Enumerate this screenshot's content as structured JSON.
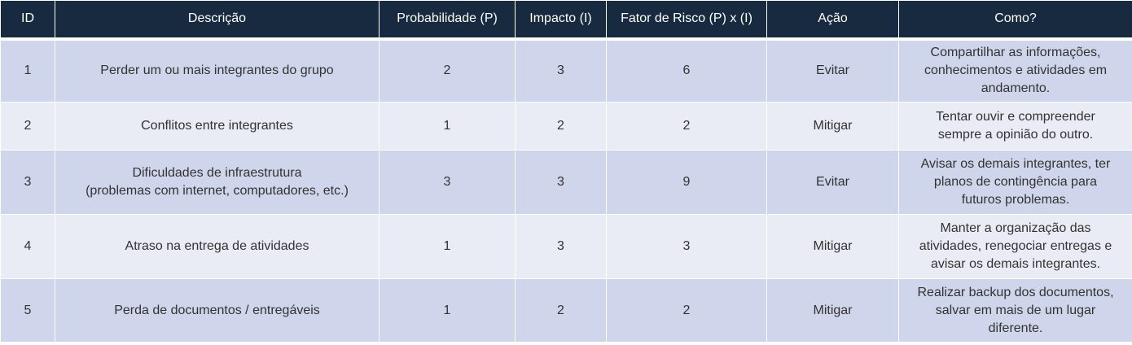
{
  "table": {
    "headers": {
      "id": "ID",
      "descricao": "Descrição",
      "probabilidade": "Probabilidade (P)",
      "impacto": "Impacto (I)",
      "fator": "Fator de Risco (P) x (I)",
      "acao": "Ação",
      "como": "Como?"
    },
    "rows": [
      {
        "id": "1",
        "descricao": "Perder um ou mais integrantes do grupo",
        "probabilidade": "2",
        "impacto": "3",
        "fator": "6",
        "acao": "Evitar",
        "como": "Compartilhar as informações,\nconhecimentos e atividades em\nandamento."
      },
      {
        "id": "2",
        "descricao": "Conflitos entre integrantes",
        "probabilidade": "1",
        "impacto": "2",
        "fator": "2",
        "acao": "Mitigar",
        "como": "Tentar ouvir e compreender\nsempre a opinião do outro."
      },
      {
        "id": "3",
        "descricao": "Dificuldades de infraestrutura\n(problemas com internet, computadores, etc.)",
        "probabilidade": "3",
        "impacto": "3",
        "fator": "9",
        "acao": "Evitar",
        "como": "Avisar os demais integrantes, ter\nplanos de contingência para\nfuturos problemas."
      },
      {
        "id": "4",
        "descricao": "Atraso na entrega de atividades",
        "probabilidade": "1",
        "impacto": "3",
        "fator": "3",
        "acao": "Mitigar",
        "como": "Manter a organização das\natividades, renegociar entregas e\navisar os demais integrantes."
      },
      {
        "id": "5",
        "descricao": "Perda de documentos / entregáveis",
        "probabilidade": "1",
        "impacto": "2",
        "fator": "2",
        "acao": "Mitigar",
        "como": "Realizar backup dos documentos,\nsalvar em mais de um lugar\ndiferente."
      }
    ]
  }
}
